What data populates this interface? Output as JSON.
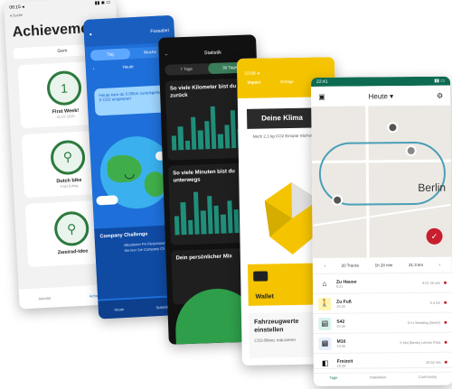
{
  "phone1": {
    "status_time": "08:15 ◂",
    "status_sub": "◂ Suche",
    "title": "Achievemen",
    "button": "Gem",
    "achievements": [
      {
        "name": "First Week!",
        "sub": "31.07.2020"
      },
      {
        "name": "Dutch bike",
        "sub": "Fast Erfolg"
      },
      {
        "name": "Zweirad-Idee",
        "sub": ""
      }
    ],
    "nav": [
      "Aktivität",
      "Achievements"
    ]
  },
  "phone2": {
    "status_time": "9:41",
    "appname": "Fossabel",
    "tabs": [
      "Tag",
      "Woche"
    ],
    "subheader": "Heute",
    "bubble": "Heute kam du 0.00km zurückgelegt, 0 CO2 eingespart",
    "challenge_title": "Company Challenge",
    "challenge_text": "Mitarbeiter Pe Fleischmann Sie Sie leer Sie Company Ch",
    "nav": [
      "Heute",
      "Statistiken"
    ]
  },
  "phone3": {
    "status_time": "10:53 ◂",
    "title": "Statistik",
    "tabs": [
      "7 Tage",
      "30 Tage"
    ],
    "card1": "So viele Kilometer bist du zurück",
    "card2": "So viele Minuten bist du unterwegs",
    "card3": "Dein persönlicher Mix",
    "bars1": [
      0.3,
      0.5,
      0.2,
      0.7,
      0.4,
      0.6,
      0.9,
      0.3,
      0.5,
      0.8,
      0.4,
      0.6
    ],
    "bars2": [
      0.4,
      0.7,
      0.3,
      0.9,
      0.5,
      0.8,
      0.6,
      0.4,
      0.7,
      0.5,
      0.9,
      0.6
    ]
  },
  "phone4": {
    "status_time": "10:08 ◂",
    "tabs": [
      "Impact",
      "Erfolge",
      "Wallet"
    ],
    "headline": "Deine Klima",
    "sub": "Noch 2,1 kg CO2 Einspar nächsten Kl",
    "wallet": "Wallet",
    "vehicle_title": "Fahrzeugwerte einstellen",
    "vehicle_sub": "CO2-Bilanz reduzieren"
  },
  "phone5": {
    "status_time": "22:41",
    "day": "Heute",
    "map_label": "Berlin",
    "stats": [
      "20 Tracks",
      "1h 28 min",
      "31.3 km"
    ],
    "trips": [
      {
        "name": "Zu Hause",
        "time": "9:21",
        "right": "9:51 39 min",
        "icon": "home-icon",
        "color": "#ffffff"
      },
      {
        "name": "Zu Fuß",
        "time": "19:26",
        "right": "0.4 km",
        "icon": "walk-icon",
        "color": "#fff4b0"
      },
      {
        "name": "S42",
        "time": "19:30",
        "right": "S+U Wedding (Berlin)",
        "icon": "train-icon",
        "color": "#d9f3ef"
      },
      {
        "name": "M10",
        "time": "19:36",
        "right": "S Hbf (Berlin) Lehrter Platz",
        "icon": "bus-icon",
        "color": "#e6eefc"
      },
      {
        "name": "Freizeit",
        "time": "19:39",
        "right": "20:34 min",
        "icon": "leisure-icon",
        "color": "#ffffff"
      }
    ],
    "nav": [
      "Tage",
      "Statistiken",
      "Community"
    ]
  }
}
